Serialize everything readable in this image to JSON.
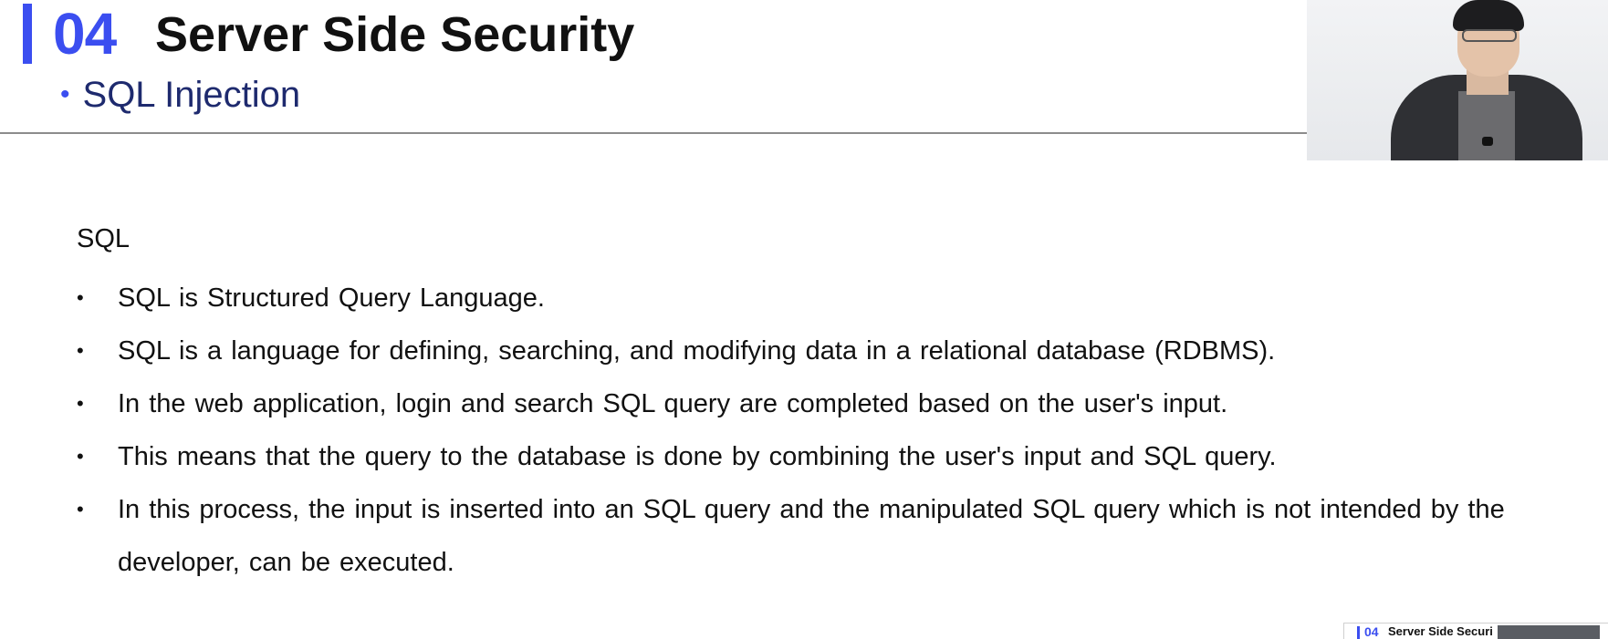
{
  "header": {
    "section_number": "04",
    "title": "Server Side Security",
    "subtitle": "SQL Injection",
    "accent_color": "#3b4ef0"
  },
  "content": {
    "heading": "SQL",
    "bullets": [
      "SQL is Structured Query Language.",
      "SQL is a language for defining, searching, and modifying data in a relational database (RDBMS).",
      "In the web application, login and search SQL query are completed based on the user's input.",
      "This means that the query to the database is done by combining the user's input and SQL query.",
      "In this process, the input is inserted into an SQL query and the manipulated SQL query which is not intended by the developer, can be executed."
    ]
  },
  "thumbnail": {
    "section_number": "04",
    "title": "Server Side Securi"
  },
  "icons": {
    "bullet": "bullet-dot-icon",
    "webcam": "presenter-webcam"
  }
}
